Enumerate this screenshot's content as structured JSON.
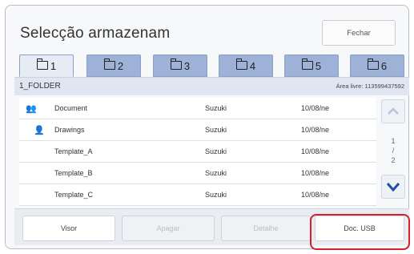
{
  "dialog": {
    "title": "Selecção armazenam",
    "close_label": "Fechar"
  },
  "tabs": [
    {
      "label": "1",
      "active": true
    },
    {
      "label": "2",
      "active": false
    },
    {
      "label": "3",
      "active": false
    },
    {
      "label": "4",
      "active": false
    },
    {
      "label": "5",
      "active": false
    },
    {
      "label": "6",
      "active": false
    }
  ],
  "folder": {
    "name": "1_FOLDER",
    "free_area": "Área livre: 113599437592"
  },
  "files": [
    {
      "icon": "group-icon",
      "name": "Document",
      "owner": "Suzuki",
      "date": "10/08/ne"
    },
    {
      "icon": "user-icon",
      "name": "Drawings",
      "owner": "Suzuki",
      "date": "10/08/ne"
    },
    {
      "icon": "",
      "name": "Template_A",
      "owner": "Suzuki",
      "date": "10/08/ne"
    },
    {
      "icon": "",
      "name": "Template_B",
      "owner": "Suzuki",
      "date": "10/08/ne"
    },
    {
      "icon": "",
      "name": "Template_C",
      "owner": "Suzuki",
      "date": "10/08/ne"
    }
  ],
  "pagination": {
    "current": "1",
    "total": "2"
  },
  "bottom": {
    "view_label": "Visor",
    "erase_label": "Apagar",
    "detail_label": "Detalhe",
    "new_doc_label": "Doc. USB"
  },
  "colors": {
    "tab": "#9db2d6",
    "highlight": "#d22230",
    "arrow": "#1f4fa3"
  }
}
